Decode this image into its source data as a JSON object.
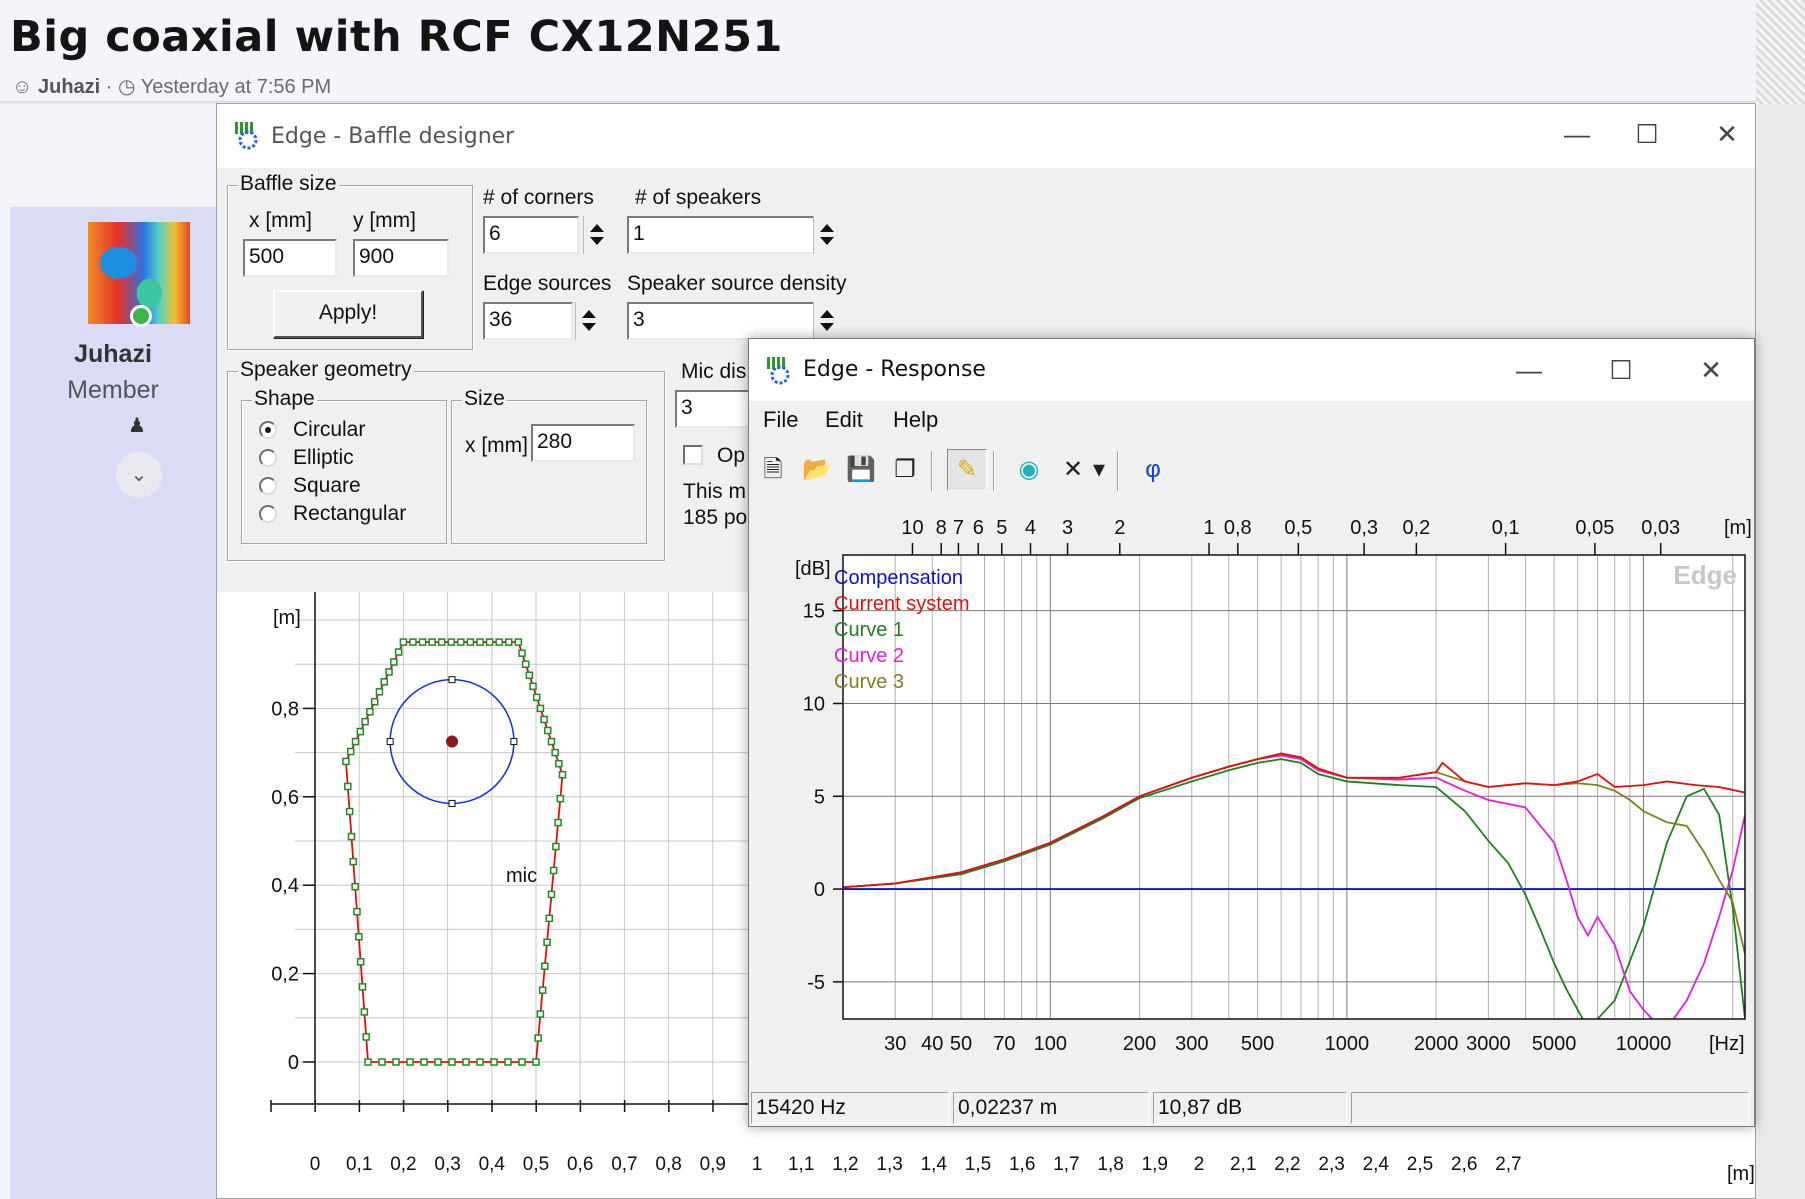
{
  "forum": {
    "thread_title": "Big coaxial with RCF CX12N251",
    "author": "Juhazi",
    "meta_sep": "·",
    "posted": "Yesterday at 7:56 PM",
    "member_name": "Juhazi",
    "member_role": "Member"
  },
  "baffle_window": {
    "title": "Edge - Baffle designer",
    "baffle_size_label": "Baffle size",
    "x_label": "x [mm]",
    "y_label": "y [mm]",
    "x_value": "500",
    "y_value": "900",
    "apply_label": "Apply!",
    "corners_label": "# of corners",
    "corners_value": "6",
    "speakers_label": "# of speakers",
    "speakers_value": "1",
    "edge_sources_label": "Edge sources",
    "edge_sources_value": "36",
    "density_label": "Speaker source density",
    "density_value": "3",
    "geometry_label": "Speaker geometry",
    "shape_label": "Shape",
    "shapes": [
      "Circular",
      "Elliptic",
      "Square",
      "Rectangular"
    ],
    "selected_shape": "Circular",
    "size_label": "Size",
    "size_x_label": "x [mm]",
    "size_x_value": "280",
    "mic_label": "Mic dis",
    "mic_value": "3",
    "option_label": "Op",
    "info_line1": "This m",
    "info_line2": "185 po",
    "plot": {
      "y_unit": "[m]",
      "x_unit": "[m]",
      "y_ticks": [
        "0,8",
        "0,6",
        "0,4",
        "0,2",
        "0"
      ],
      "x_ticks": [
        "0",
        "0,1",
        "0,2",
        "0,3",
        "0,4",
        "0,5",
        "0,6",
        "0,7",
        "0,8",
        "0,9",
        "1",
        "1,1",
        "1,2",
        "1,3",
        "1,4",
        "1,5",
        "1,6",
        "1,7",
        "1,8",
        "1,9",
        "2",
        "2,1",
        "2,2",
        "2,3",
        "2,4",
        "2,5",
        "2,6",
        "2,7"
      ],
      "mic_label": "mic",
      "baffle_color": "#1f8a1f",
      "edge_color": "#e01010",
      "speaker_color": "#1030e0"
    }
  },
  "response_window": {
    "title": "Edge - Response",
    "menu": [
      "File",
      "Edit",
      "Help"
    ],
    "toolbar_icons": [
      "new-icon",
      "open-icon",
      "save-icon",
      "copy-icon",
      "pen-icon",
      "speaker-icon",
      "delete-icon",
      "dropdown-icon",
      "phase-icon"
    ],
    "phase_glyph": "φ",
    "chart_data": {
      "type": "line",
      "xlabel": "[Hz]",
      "ylabel": "[dB]",
      "top_axis_unit": "[m]",
      "x_scale": "log",
      "xlim": [
        20,
        22000
      ],
      "ylim": [
        -7,
        18
      ],
      "x_ticks": [
        "30",
        "40",
        "50",
        "70",
        "100",
        "200",
        "300",
        "500",
        "1000",
        "2000",
        "3000",
        "5000",
        "10000"
      ],
      "y_ticks": [
        "15",
        "10",
        "5",
        "0",
        "-5"
      ],
      "top_ticks": [
        "10",
        "8",
        "7",
        "6",
        "5",
        "4",
        "3",
        "2",
        "1",
        "0,8",
        "0,5",
        "0,3",
        "0,2",
        "0,1",
        "0,05",
        "0,03"
      ],
      "watermark": "Edge",
      "series": [
        {
          "name": "Compensation",
          "color": "#1010d0",
          "x": [
            20,
            22000
          ],
          "y": [
            0,
            0
          ]
        },
        {
          "name": "Current system",
          "color": "#e01010",
          "x": [
            20,
            30,
            50,
            70,
            100,
            150,
            200,
            300,
            400,
            500,
            600,
            700,
            800,
            1000,
            1500,
            2000,
            2100,
            2500,
            3000,
            4000,
            5000,
            6000,
            7000,
            8000,
            10000,
            12000,
            15000,
            18000,
            22000
          ],
          "y": [
            0.1,
            0.3,
            0.9,
            1.6,
            2.5,
            3.9,
            5.0,
            6.0,
            6.6,
            7.0,
            7.3,
            7.1,
            6.5,
            6.0,
            6.0,
            6.3,
            6.8,
            5.8,
            5.5,
            5.7,
            5.6,
            5.8,
            6.2,
            5.5,
            5.6,
            5.8,
            5.6,
            5.5,
            5.2
          ]
        },
        {
          "name": "Curve 1",
          "color": "#208020",
          "x": [
            20,
            30,
            50,
            70,
            100,
            150,
            200,
            300,
            400,
            500,
            600,
            700,
            800,
            1000,
            1500,
            2000,
            2500,
            3000,
            3500,
            4000,
            4500,
            5000,
            5500,
            6000,
            6500,
            7000,
            8000,
            10000,
            12000,
            14000,
            16000,
            18000,
            20000,
            22000
          ],
          "y": [
            0.1,
            0.3,
            0.8,
            1.5,
            2.4,
            3.8,
            4.9,
            5.8,
            6.4,
            6.8,
            7.0,
            6.8,
            6.2,
            5.8,
            5.6,
            5.5,
            4.2,
            2.6,
            1.4,
            -0.3,
            -2.2,
            -4.0,
            -5.4,
            -6.5,
            -7.5,
            -7.0,
            -6.0,
            -2.0,
            2.5,
            5.0,
            5.4,
            4.0,
            -1.0,
            -7.0
          ]
        },
        {
          "name": "Curve 2",
          "color": "#e020e0",
          "x": [
            20,
            30,
            50,
            70,
            100,
            150,
            200,
            300,
            400,
            500,
            600,
            700,
            800,
            1000,
            1500,
            2000,
            2500,
            3000,
            4000,
            5000,
            5500,
            6000,
            6500,
            7000,
            8000,
            9000,
            10000,
            11000,
            12000,
            14000,
            16000,
            18000,
            20000,
            22000
          ],
          "y": [
            0.1,
            0.3,
            0.9,
            1.6,
            2.5,
            3.9,
            5.0,
            6.0,
            6.6,
            7.0,
            7.2,
            7.0,
            6.4,
            6.0,
            5.9,
            6.0,
            5.3,
            4.8,
            4.4,
            2.5,
            0.5,
            -1.5,
            -2.5,
            -1.5,
            -3.0,
            -5.5,
            -6.5,
            -7.2,
            -7.5,
            -6.0,
            -4.0,
            -1.5,
            1.0,
            4.0
          ]
        },
        {
          "name": "Curve 3",
          "color": "#808020",
          "x": [
            20,
            30,
            50,
            70,
            100,
            150,
            200,
            300,
            400,
            500,
            600,
            700,
            800,
            1000,
            1500,
            2000,
            2500,
            3000,
            4000,
            5000,
            6000,
            7000,
            8000,
            9000,
            10000,
            12000,
            14000,
            16000,
            18000,
            20000,
            22000
          ],
          "y": [
            0.1,
            0.3,
            0.9,
            1.6,
            2.5,
            3.9,
            5.0,
            6.0,
            6.6,
            7.0,
            7.3,
            7.1,
            6.5,
            6.0,
            6.0,
            6.3,
            5.8,
            5.5,
            5.7,
            5.6,
            5.7,
            5.6,
            5.3,
            4.8,
            4.2,
            3.6,
            3.4,
            2.0,
            0.5,
            -0.7,
            -3.5
          ]
        }
      ]
    },
    "status": {
      "freq": "15420 Hz",
      "wavelength": "0,02237 m",
      "level": "10,87 dB"
    }
  }
}
